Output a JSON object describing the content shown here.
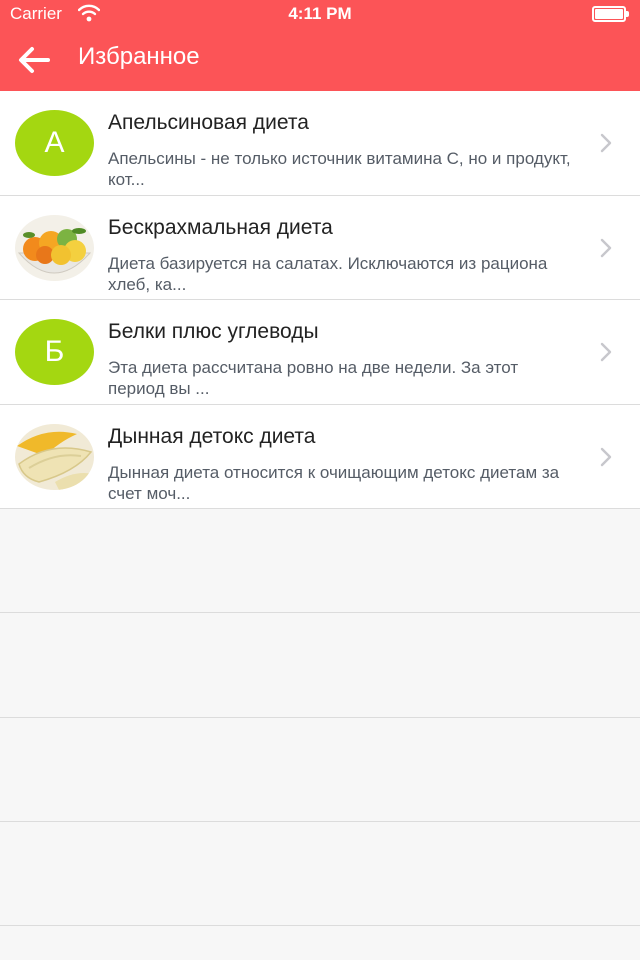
{
  "status_bar": {
    "carrier": "Carrier",
    "time": "4:11 PM",
    "battery_level": 1.0
  },
  "nav": {
    "title": "Избранное",
    "back_icon": "arrow-left-icon"
  },
  "colors": {
    "header": "#fc5457",
    "letter_avatar": "#a4d711",
    "title_text": "#222222",
    "desc_text": "#555c66",
    "separator": "#dcdcdc"
  },
  "items": [
    {
      "avatar_type": "letter",
      "avatar_letter": "А",
      "title": "Апельсиновая диета",
      "description": "Апельсины - не только источник витамина C, но и продукт, кот..."
    },
    {
      "avatar_type": "image",
      "avatar_image": "fruit-bowl-photo",
      "title": "Бескрахмальная диета",
      "description": "Диета базируется на салатах. Исключаются из рациона хлеб, ка..."
    },
    {
      "avatar_type": "letter",
      "avatar_letter": "Б",
      "title": "Белки плюс углеводы",
      "description": "Эта диета рассчитана ровно на две недели. За этот период вы ..."
    },
    {
      "avatar_type": "image",
      "avatar_image": "melon-slices-photo",
      "title": "Дынная детокс диета",
      "description": "Дынная диета относится к очищающим детокс диетам за счет моч..."
    }
  ]
}
